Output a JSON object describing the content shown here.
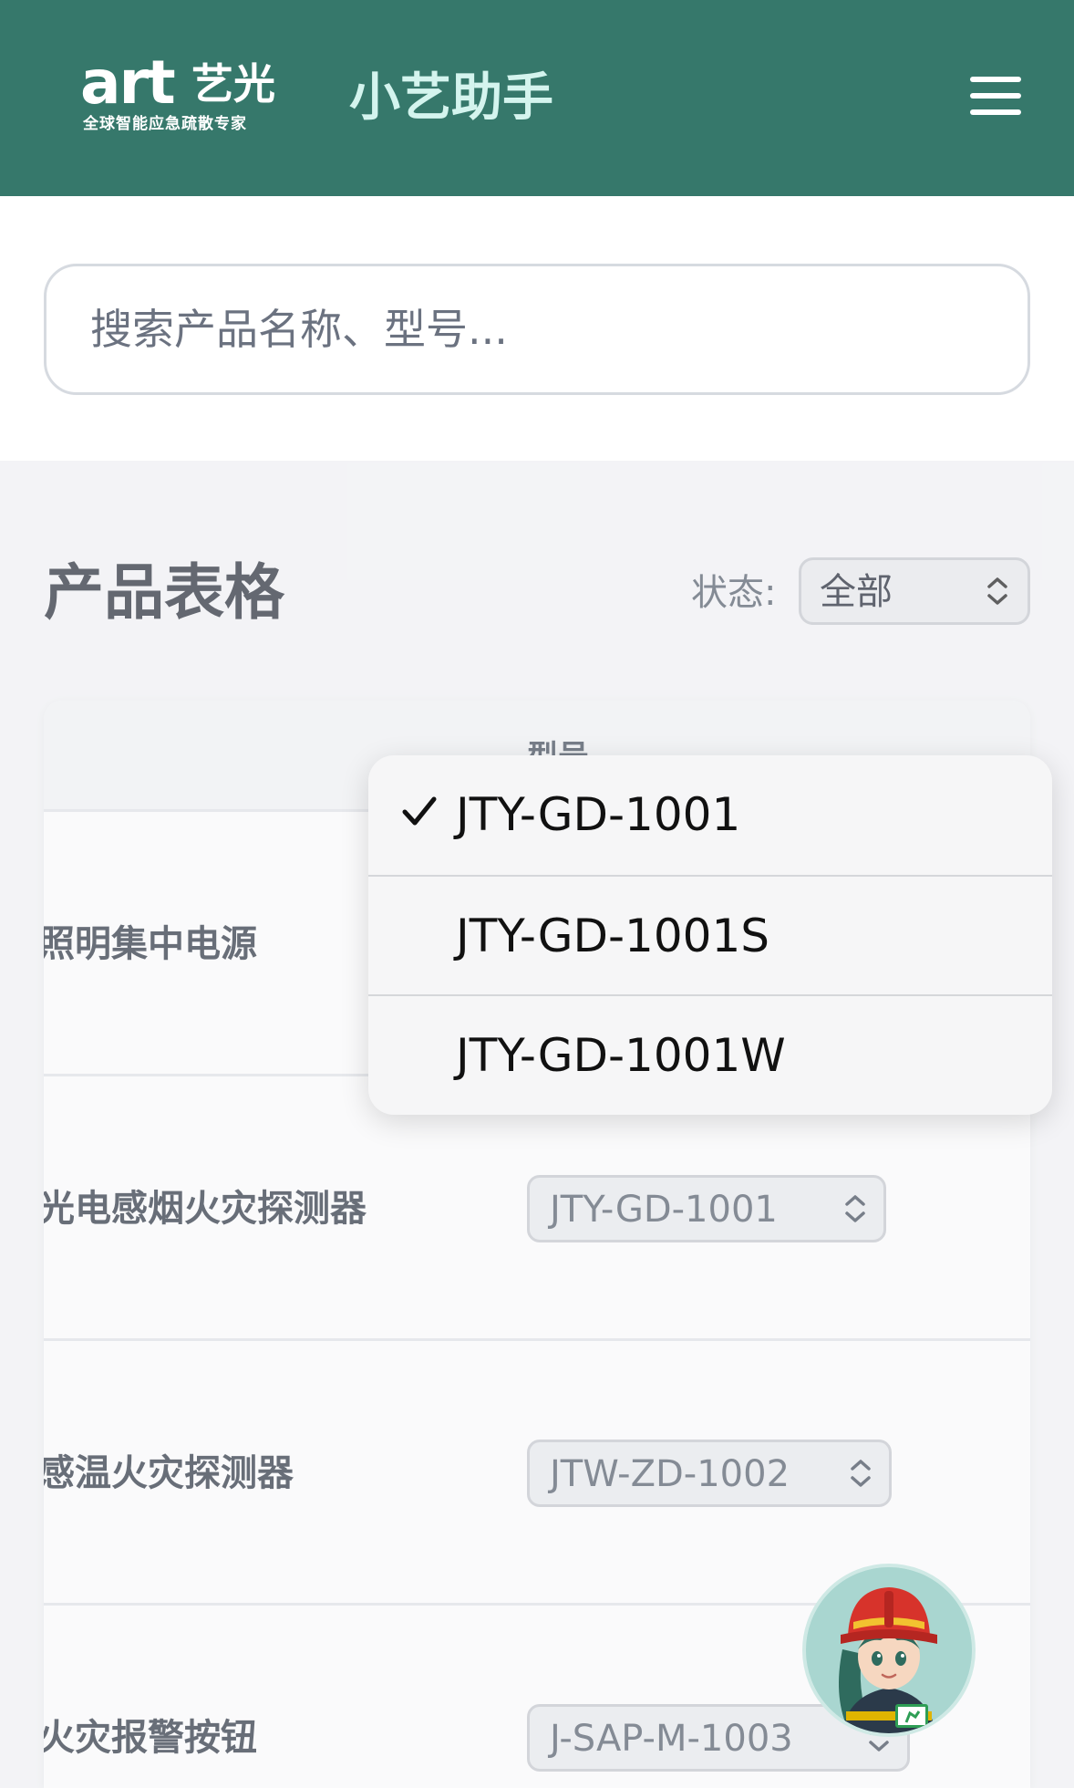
{
  "header": {
    "logo_word": "art",
    "logo_cn": "艺光",
    "logo_tagline": "全球智能应急疏散专家",
    "app_title": "小艺助手",
    "menu_icon": "hamburger-menu-icon"
  },
  "search": {
    "placeholder": "搜索产品名称、型号...",
    "value": ""
  },
  "section": {
    "title": "产品表格",
    "status_label": "状态:",
    "status_value": "全部"
  },
  "table": {
    "columns": [
      "",
      "型号"
    ],
    "rows": [
      {
        "name": "照明集中电源",
        "model": "JTY-GD-1001"
      },
      {
        "name": "光电感烟火灾探测器",
        "model": "JTY-GD-1001"
      },
      {
        "name": "感温火灾探测器",
        "model": "JTW-ZD-1002"
      },
      {
        "name": "火灾报警按钮",
        "model": "J-SAP-M-1003"
      }
    ]
  },
  "dropdown": {
    "selected": "JTY-GD-1001",
    "options": [
      "JTY-GD-1001",
      "JTY-GD-1001S",
      "JTY-GD-1001W"
    ]
  },
  "colors": {
    "header_bg": "#36786b",
    "app_title": "#d4f4ee",
    "assistant_bg": "#a9d6d0"
  }
}
